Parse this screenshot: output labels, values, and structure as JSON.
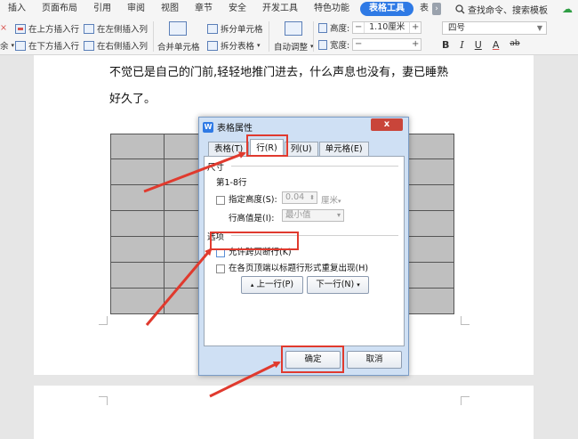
{
  "menu": {
    "tabs": [
      "插入",
      "页面布局",
      "引用",
      "审阅",
      "视图",
      "章节",
      "安全",
      "开发工具",
      "特色功能"
    ],
    "active_tab": "表格工具",
    "partial_tab": "表",
    "more_label": "›",
    "search_label": "查找命令、搜索模板"
  },
  "ribbon": {
    "insert_above": "在上方插入行",
    "insert_left": "在左侧插入列",
    "insert_below": "在下方插入行",
    "insert_right": "在右侧插入列",
    "merge_cells": "合并单元格",
    "split_cells": "拆分单元格",
    "split_table": "拆分表格",
    "auto_fit": "自动调整",
    "height_label": "高度:",
    "height_value": "1.10厘米",
    "width_label": "宽度:",
    "width_value": "",
    "spin_minus": "−",
    "spin_plus": "+",
    "font_size": "四号",
    "bold": "B",
    "italic": "I",
    "underline": "U",
    "font_color": "A",
    "highlight": "ab"
  },
  "document": {
    "line1": "不觉已是自己的门前,轻轻地推门进去，什么声息也没有，妻已睡熟",
    "line2": "好久了。"
  },
  "dialog": {
    "app_icon": "W",
    "title": "表格属性",
    "close_label": "x",
    "tabs": [
      "表格(T)",
      "行(R)",
      "列(U)",
      "单元格(E)"
    ],
    "size_group": "尺寸",
    "rows_label": "第1-8行",
    "specify_height": "指定高度(S):",
    "height_value": "0.04",
    "height_unit": "厘米",
    "row_height_is": "行高值是(I):",
    "row_height_mode": "最小值",
    "options_group": "选项",
    "allow_break": "允许跨页断行(K)",
    "repeat_header": "在各页顶端以标题行形式重复出现(H)",
    "prev_row": "上一行(P)",
    "next_row": "下一行(N)",
    "ok": "确定",
    "cancel": "取消"
  },
  "colors": {
    "accent": "#2f7ae5",
    "highlight_border": "#e03a2e",
    "dialog_bg": "#cfe0f4",
    "table_cell": "#bfbfbf"
  }
}
